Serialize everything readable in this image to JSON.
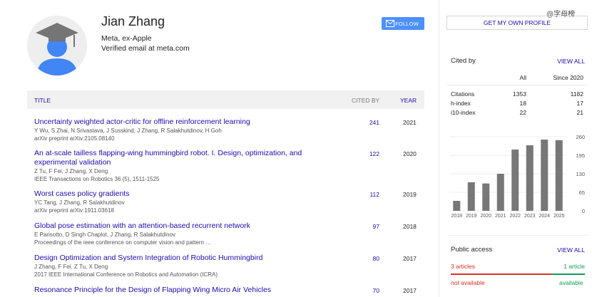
{
  "profile": {
    "name": "Jian Zhang",
    "affiliation": "Meta, ex-Apple",
    "email": "Verified email at meta.com",
    "follow_label": "FOLLOW"
  },
  "table": {
    "col_title": "TITLE",
    "col_cited": "CITED BY",
    "col_year": "YEAR"
  },
  "articles": [
    {
      "title": "Uncertainty weighted actor-critic for offline reinforcement learning",
      "authors": "Y Wu, S Zhai, N Srivastava, J Susskind, J Zhang, R Salakhutdinov, H Goh",
      "venue": "arXiv preprint arXiv:2105.08140",
      "cites": "241",
      "year": "2021"
    },
    {
      "title": "An at-scale tailless flapping-wing hummingbird robot. I. Design, optimization, and experimental validation",
      "authors": "Z Tu, F Fei, J Zhang, X Deng",
      "venue": "IEEE Transactions on Robotics 36 (5), 1511-1525",
      "cites": "122",
      "year": "2020"
    },
    {
      "title": "Worst cases policy gradients",
      "authors": "YC Tang, J Zhang, R Salakhutdinov",
      "venue": "arXiv preprint arXiv:1911.03618",
      "cites": "112",
      "year": "2019"
    },
    {
      "title": "Global pose estimation with an attention-based recurrent network",
      "authors": "E Parisotto, D Singh Chaplot, J Zhang, R Salakhutdinov",
      "venue": "Proceedings of the ieee conference on computer vision and pattern …",
      "cites": "97",
      "year": "2018"
    },
    {
      "title": "Design Optimization and System Integration of Robotic Hummingbird",
      "authors": "J Zhang, F Fei, Z Tu, X Deng",
      "venue": "2017 IEEE International Conference on Robotics and Automation (ICRA)",
      "cites": "80",
      "year": "2017"
    },
    {
      "title": "Resonance Principle for the Design of Flapping Wing Micro Air Vehicles",
      "authors": "",
      "venue": "",
      "cites": "70",
      "year": "2017"
    }
  ],
  "sidebar": {
    "get_profile_label": "GET MY OWN PROFILE",
    "watermark": "@字母榜",
    "cited_by_title": "Cited by",
    "view_all": "VIEW ALL",
    "col_all": "All",
    "col_since": "Since 2020",
    "stats": [
      {
        "label": "Citations",
        "all": "1353",
        "since": "1182"
      },
      {
        "label": "h-index",
        "all": "18",
        "since": "17"
      },
      {
        "label": "i10-index",
        "all": "22",
        "since": "21"
      }
    ],
    "public_access_title": "Public access",
    "public_view_all": "VIEW ALL",
    "articles_unavailable": "3 articles",
    "articles_available": "1 article",
    "not_available": "not available",
    "available": "available",
    "colors": {
      "unavailable": "#d93025",
      "available": "#0f9d58",
      "link": "#1a0dab"
    }
  },
  "chart_data": {
    "type": "bar",
    "categories": [
      "2018",
      "2019",
      "2020",
      "2021",
      "2022",
      "2023",
      "2024",
      "2025"
    ],
    "values": [
      35,
      100,
      96,
      130,
      215,
      230,
      250,
      248
    ],
    "yticks": [
      "260",
      "195",
      "130",
      "65",
      "0"
    ],
    "ylim": [
      0,
      260
    ]
  }
}
